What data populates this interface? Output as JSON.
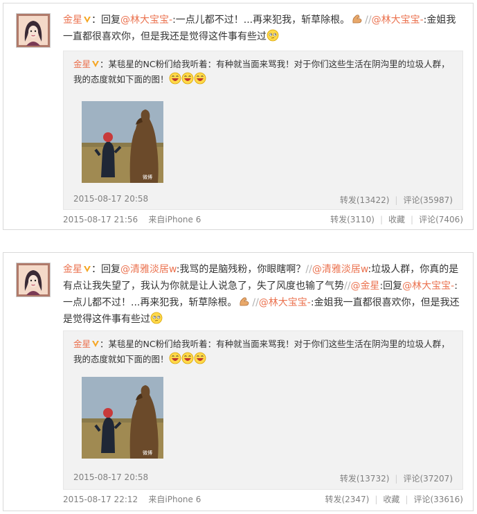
{
  "posts": [
    {
      "author": "金星",
      "text_parts": [
        {
          "t": "：回复",
          "c": "plain"
        },
        {
          "t": "@林大宝宝-",
          "c": "mention"
        },
        {
          "t": ":一点儿都不过！...再来犯我，斩草除根。",
          "c": "plain"
        },
        {
          "t": "//",
          "c": "sep"
        },
        {
          "t": "@林大宝宝-",
          "c": "mention"
        },
        {
          "t": ":金姐我一直都很喜欢你，但是我还是觉得这件事有些过",
          "c": "plain"
        }
      ],
      "quote": {
        "author": "金星",
        "text": "：某毯星的NC粉们给我听着：有种就当面来骂我！对于你们这些生活在阴沟里的垃圾人群，我的态度就如下面的图！",
        "image_watermark": "微博",
        "time": "2015-08-17 20:58",
        "repost": "转发(13422)",
        "comment": "评论(35987)"
      },
      "time": "2015-08-17 21:56",
      "source": "来自iPhone 6",
      "repost": "转发(3110)",
      "favorite": "收藏",
      "comment": "评论(7406)"
    },
    {
      "author": "金星",
      "text_parts": [
        {
          "t": "：回复",
          "c": "plain"
        },
        {
          "t": "@清雅淡居w",
          "c": "mention"
        },
        {
          "t": ":我骂的是脑残粉，你眼瞎啊？",
          "c": "plain"
        },
        {
          "t": "//",
          "c": "sep"
        },
        {
          "t": "@清雅淡居w",
          "c": "mention"
        },
        {
          "t": ":垃圾人群，你真的是有点让我失望了，我认为你就是让人说急了，失了风度也输了气势",
          "c": "plain"
        },
        {
          "t": "//",
          "c": "sep"
        },
        {
          "t": "@金星",
          "c": "mention"
        },
        {
          "t": ":回复",
          "c": "plain"
        },
        {
          "t": "@林大宝宝-",
          "c": "mention"
        },
        {
          "t": ":一点儿都不过！...再来犯我，斩草除根。",
          "c": "plain"
        },
        {
          "t": "//",
          "c": "sep"
        },
        {
          "t": "@林大宝宝-",
          "c": "mention"
        },
        {
          "t": ":金姐我一直都很喜欢你，但是我还是觉得这件事有些过",
          "c": "plain"
        }
      ],
      "quote": {
        "author": "金星",
        "text": "：某毯星的NC粉们给我听着：有种就当面来骂我！对于你们这些生活在阴沟里的垃圾人群，我的态度就如下面的图！",
        "image_watermark": "微博",
        "time": "2015-08-17 20:58",
        "repost": "转发(13732)",
        "comment": "评论(37207)"
      },
      "time": "2015-08-17 22:12",
      "source": "来自iPhone 6",
      "repost": "转发(2347)",
      "favorite": "收藏",
      "comment": "评论(33616)"
    }
  ],
  "colors": {
    "accent": "#eb7350",
    "meta": "#808080",
    "quote_bg": "#f2f2f2"
  },
  "icons": {
    "verified": "verified-v-icon",
    "flex": "flexed-arm-emoji-icon",
    "think": "thinking-face-emoji-icon",
    "laugh": "laughing-face-emoji-icon"
  }
}
